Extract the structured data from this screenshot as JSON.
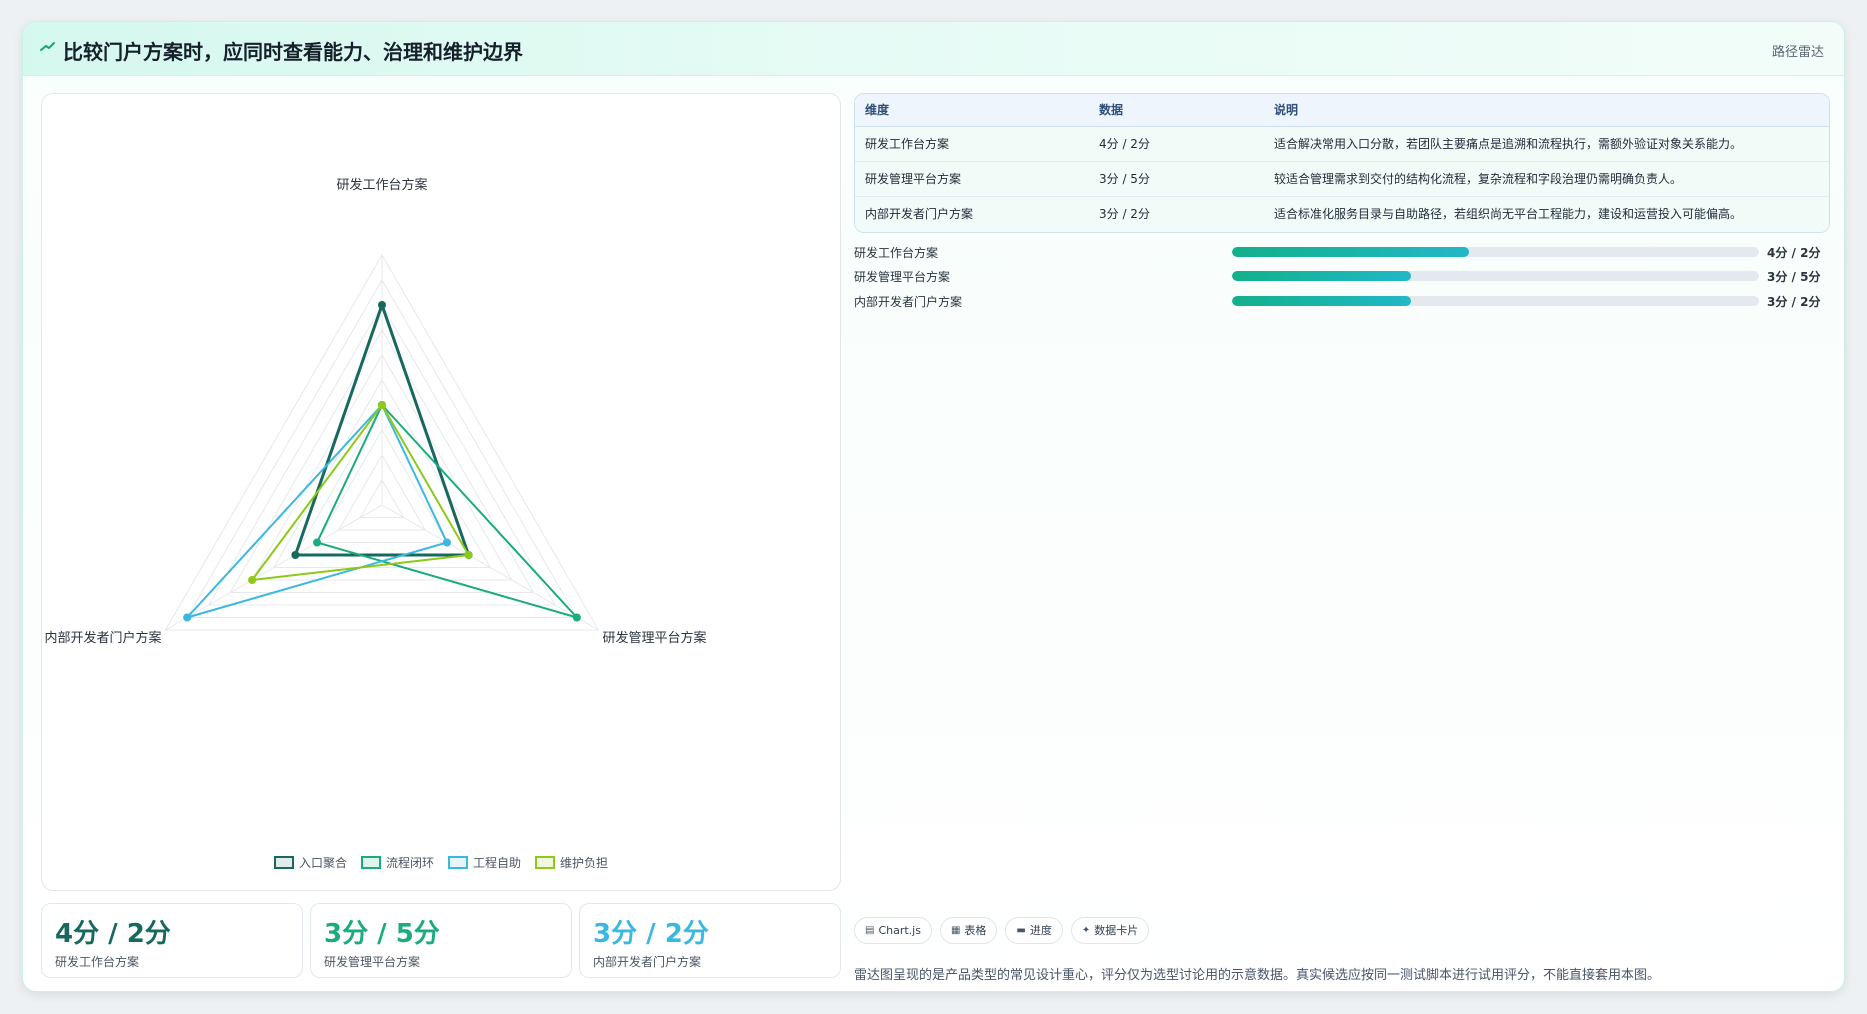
{
  "header": {
    "title": "比较门户方案时，应同时查看能力、治理和维护边界",
    "tag": "路径雷达"
  },
  "colors": {
    "series": [
      "#17685e",
      "#1aab7f",
      "#3bb8e0",
      "#8cc919"
    ]
  },
  "chart_data": {
    "type": "radar",
    "axes": [
      "研发工作台方案",
      "研发管理平台方案",
      "内部开发者门户方案"
    ],
    "range": [
      0,
      5
    ],
    "grid_rings": 10,
    "series": [
      {
        "name": "入口聚合",
        "values": [
          4,
          2,
          2
        ]
      },
      {
        "name": "流程闭环",
        "values": [
          2,
          4.5,
          1.5
        ]
      },
      {
        "name": "工程自助",
        "values": [
          2,
          1.5,
          4.5
        ]
      },
      {
        "name": "维护负担",
        "values": [
          2,
          2,
          3
        ]
      }
    ]
  },
  "table": {
    "headers": [
      "维度",
      "数据",
      "说明"
    ],
    "rows": [
      [
        "研发工作台方案",
        "4分 / 2分",
        "适合解决常用入口分散，若团队主要痛点是追溯和流程执行，需额外验证对象关系能力。"
      ],
      [
        "研发管理平台方案",
        "3分 / 5分",
        "较适合管理需求到交付的结构化流程，复杂流程和字段治理仍需明确负责人。"
      ],
      [
        "内部开发者门户方案",
        "3分 / 2分",
        "适合标准化服务目录与自助路径，若组织尚无平台工程能力，建设和运营投入可能偏高。"
      ]
    ]
  },
  "progress": [
    {
      "label": "研发工作台方案",
      "fraction": 0.45,
      "value": "4分 / 2分"
    },
    {
      "label": "研发管理平台方案",
      "fraction": 0.34,
      "value": "3分 / 5分"
    },
    {
      "label": "内部开发者门户方案",
      "fraction": 0.34,
      "value": "3分 / 2分"
    }
  ],
  "kpis": [
    {
      "value": "4分 / 2分",
      "label": "研发工作台方案",
      "color": "#17685e"
    },
    {
      "value": "3分 / 5分",
      "label": "研发管理平台方案",
      "color": "#1aab7f"
    },
    {
      "value": "3分 / 2分",
      "label": "内部开发者门户方案",
      "color": "#3bb8e0"
    }
  ],
  "chips": [
    {
      "icon": "chart-icon",
      "label": "Chart.js"
    },
    {
      "icon": "table-icon",
      "label": "表格"
    },
    {
      "icon": "progress-icon",
      "label": "进度"
    },
    {
      "icon": "card-icon",
      "label": "数据卡片"
    }
  ],
  "note": "雷达图呈现的是产品类型的常见设计重心，评分仅为选型讨论用的示意数据。真实候选应按同一测试脚本进行试用评分，不能直接套用本图。"
}
